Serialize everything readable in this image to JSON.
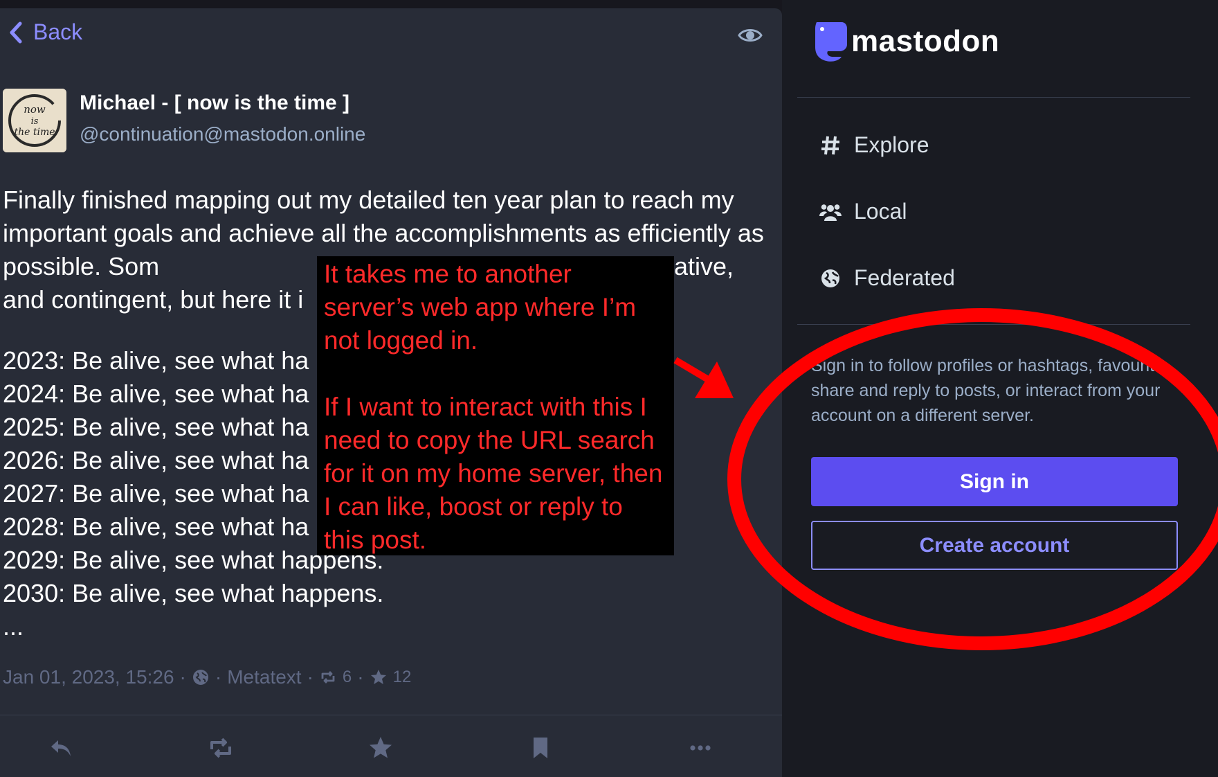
{
  "header": {
    "back_label": "Back"
  },
  "post": {
    "author_name": "Michael - [ now is the time ]",
    "author_handle": "@continuation@mastodon.online",
    "avatar_text": [
      "now",
      "is",
      "the time"
    ],
    "intro": "Finally finished mapping out my detailed ten year plan to reach my important goals and achieve all the accomplishments as efficiently as possible. Som",
    "intro_fragment_right": "ative,",
    "intro_line4": "and contingent, but here it i",
    "plan_lines": [
      "2023: Be alive, see what ha",
      "2024: Be alive, see what ha",
      "2025: Be alive, see what ha",
      "2026: Be alive, see what ha",
      "2027: Be alive, see what ha",
      "2028: Be alive, see what ha",
      "2029: Be alive, see what happens.",
      "2030: Be alive, see what happens.",
      "..."
    ],
    "meta": {
      "date": "Jan 01, 2023, 15:26",
      "sep": "·",
      "app": "Metatext",
      "boosts": "6",
      "favourites": "12"
    }
  },
  "annotation": {
    "para1": "It takes me to another server’s web app where I’m not logged in.",
    "para2": "If I want to interact with this I need to copy the URL search for it on my home server, then I can like, boost or reply to this post."
  },
  "sidebar": {
    "brand": "mastodon",
    "nav": [
      {
        "label": "Explore",
        "icon": "hashtag-icon"
      },
      {
        "label": "Local",
        "icon": "users-icon"
      },
      {
        "label": "Federated",
        "icon": "globe-icon"
      }
    ],
    "signin_prompt": "Sign in to follow profiles or hashtags, favourite, share and reply to posts, or interact from your account on a different server.",
    "signin_label": "Sign in",
    "create_label": "Create account"
  },
  "colors": {
    "accent": "#8c8dff",
    "primary_button": "#5c4df0",
    "annotation_red": "#ff2a2a",
    "panel_bg": "#282c37",
    "sidebar_bg": "#191b22"
  }
}
